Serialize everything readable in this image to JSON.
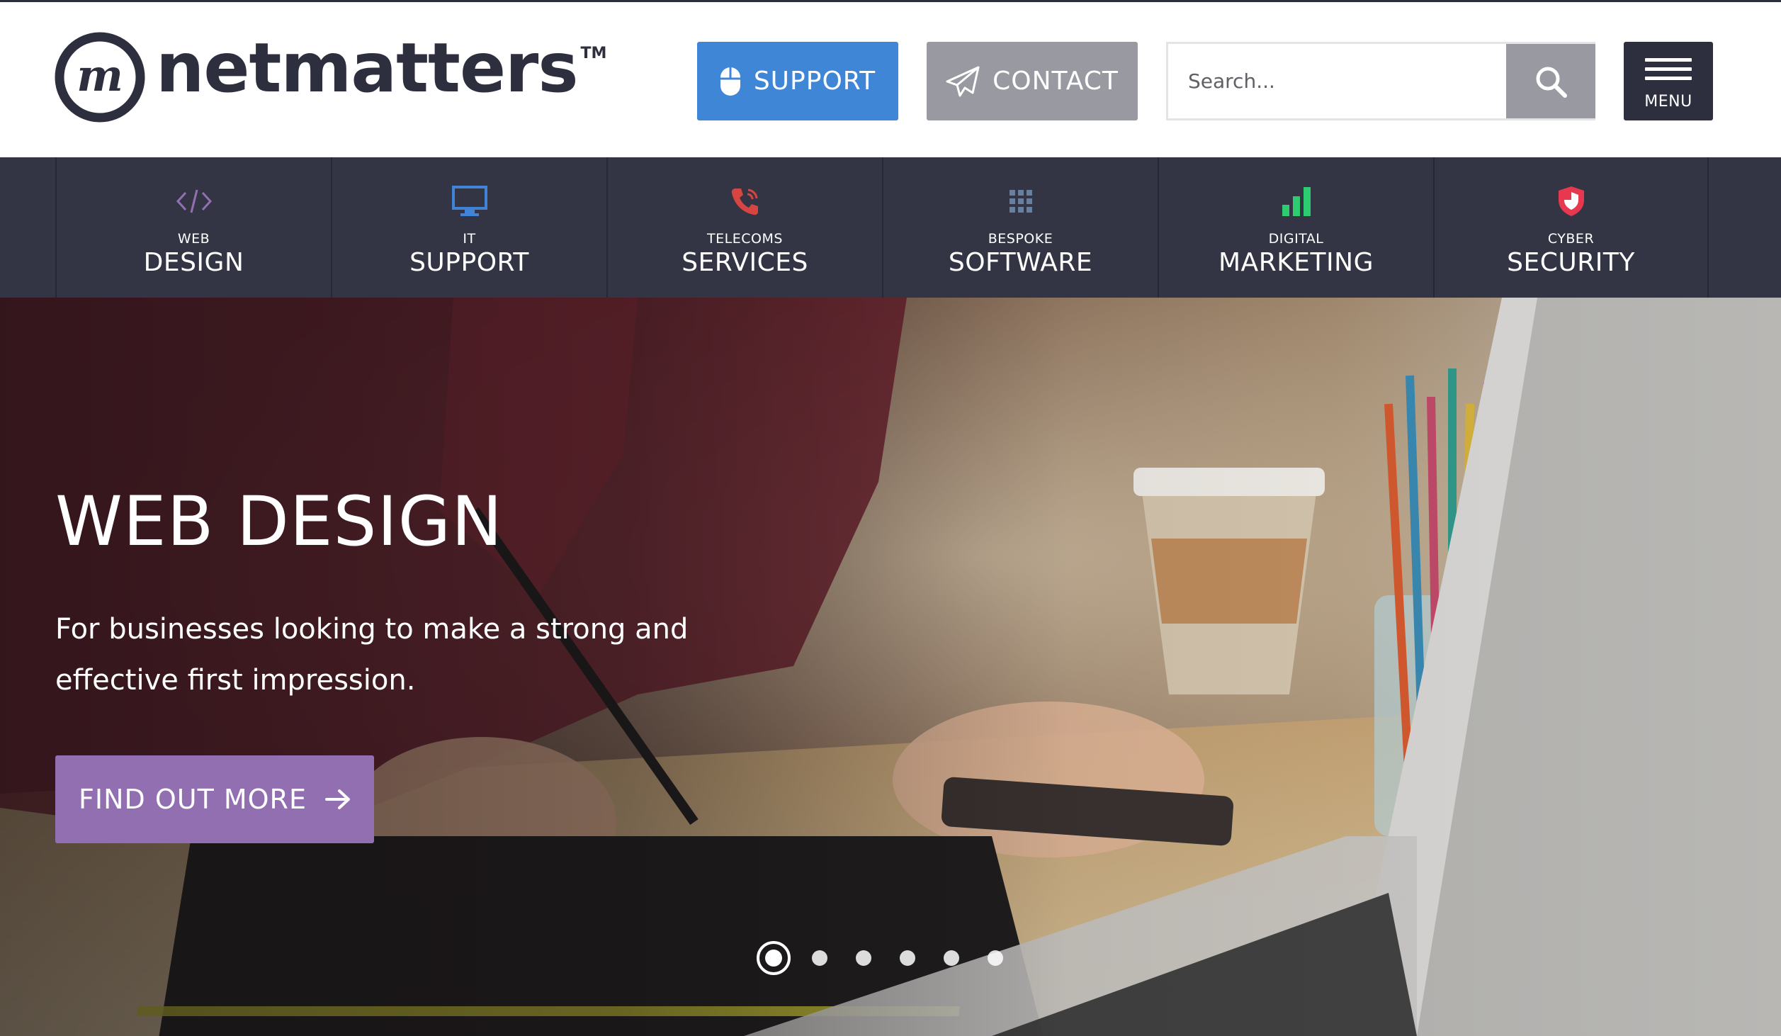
{
  "header": {
    "logo_text": "netmatters",
    "logo_tm": "TM",
    "support_label": "SUPPORT",
    "contact_label": "CONTACT",
    "search_placeholder": "Search...",
    "menu_label": "MENU"
  },
  "nav": {
    "items": [
      {
        "small": "WEB",
        "big": "DESIGN",
        "icon": "code-icon",
        "color": "#926fb1"
      },
      {
        "small": "IT",
        "big": "SUPPORT",
        "icon": "monitor-icon",
        "color": "#4183d7"
      },
      {
        "small": "TELECOMS",
        "big": "SERVICES",
        "icon": "phone-icon",
        "color": "#d64541"
      },
      {
        "small": "BESPOKE",
        "big": "SOFTWARE",
        "icon": "grid-icon",
        "color": "#67809f"
      },
      {
        "small": "DIGITAL",
        "big": "MARKETING",
        "icon": "bar-chart-icon",
        "color": "#2ecc71"
      },
      {
        "small": "CYBER",
        "big": "SECURITY",
        "icon": "shield-icon",
        "color": "#e8384f"
      }
    ]
  },
  "hero": {
    "title": "WEB DESIGN",
    "subtitle": "For businesses looking to make a strong and effective first impression.",
    "cta_label": "FIND OUT MORE",
    "slide_count": 6,
    "active_slide": 1
  },
  "colors": {
    "dark": "#2e2f3e",
    "nav_bg": "#333544",
    "support_blue": "#3f87d6",
    "contact_grey": "#999aa1",
    "cta_purple": "#926fb1"
  }
}
